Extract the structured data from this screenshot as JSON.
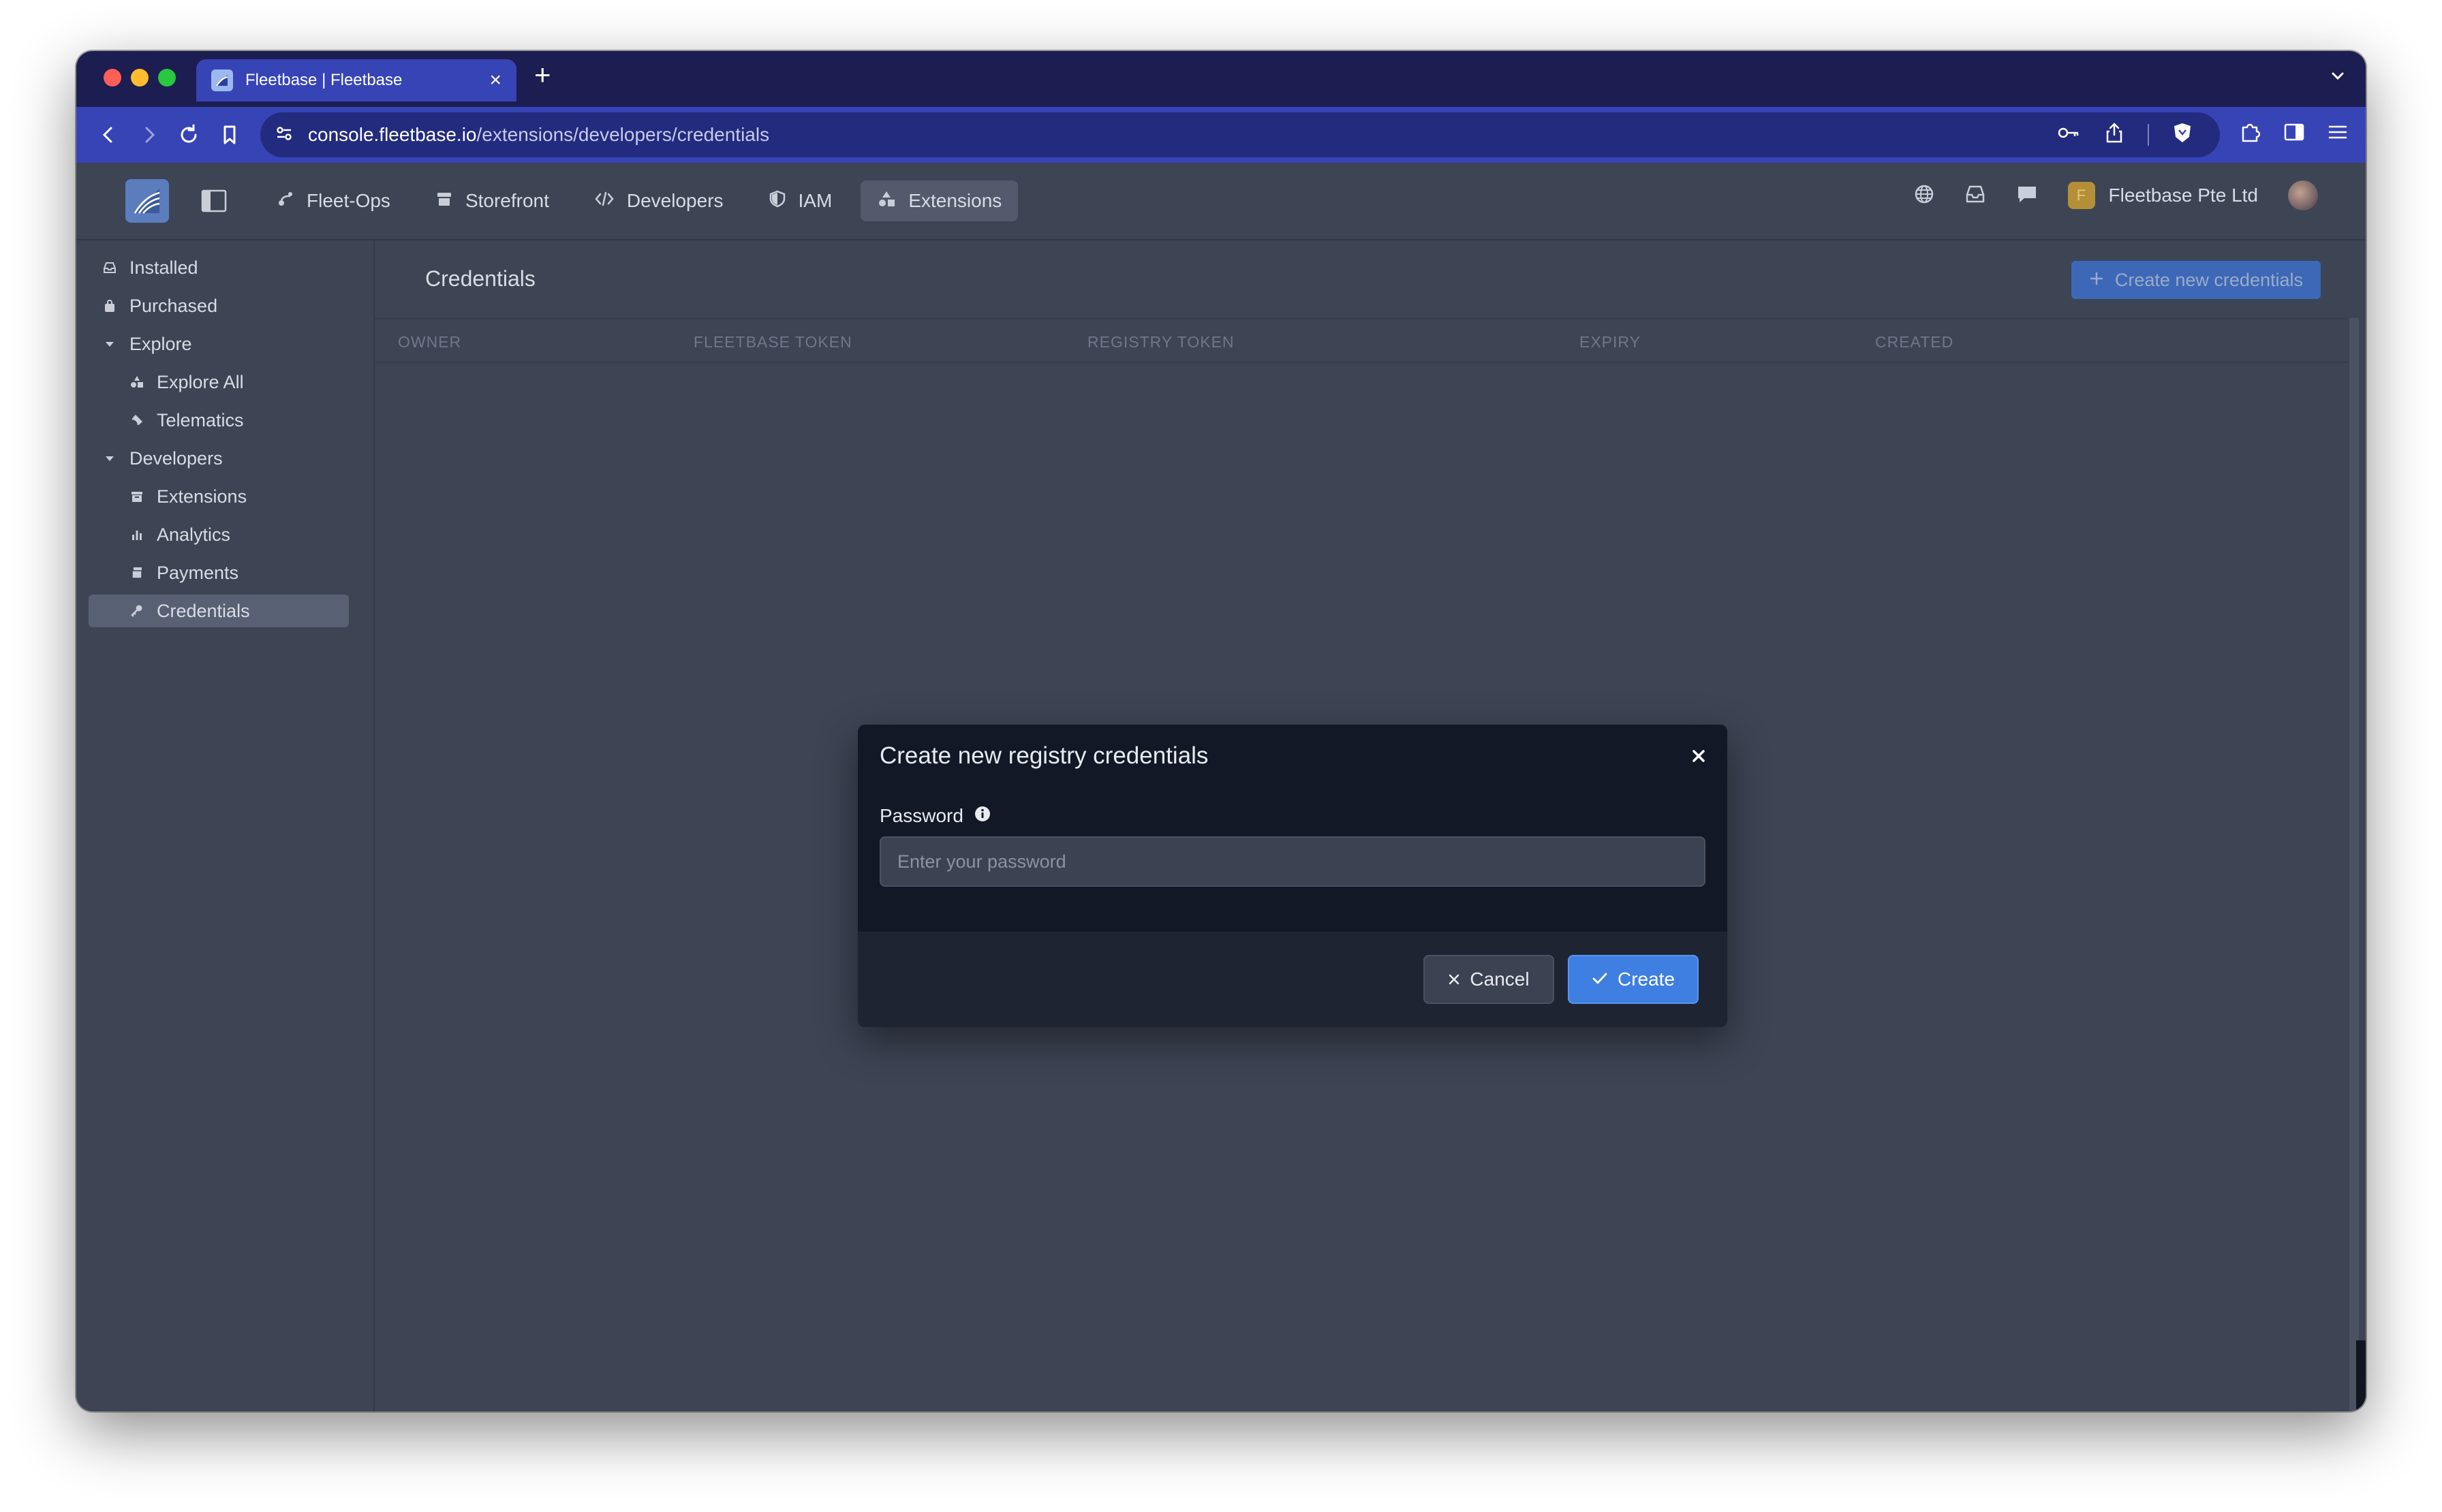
{
  "browser": {
    "tab_title": "Fleetbase | Fleetbase",
    "new_tab_symbol": "+",
    "close_symbol": "×",
    "url_domain": "console.fleetbase.io",
    "url_path": "/extensions/developers/credentials"
  },
  "header": {
    "nav": [
      {
        "label": "Fleet-Ops",
        "icon": "route-icon"
      },
      {
        "label": "Storefront",
        "icon": "store-icon"
      },
      {
        "label": "Developers",
        "icon": "code-icon"
      },
      {
        "label": "IAM",
        "icon": "shield-icon"
      },
      {
        "label": "Extensions",
        "icon": "shapes-icon",
        "active": true
      }
    ],
    "org_initial": "F",
    "org_name": "Fleetbase Pte Ltd"
  },
  "sidebar": {
    "items": [
      {
        "label": "Installed",
        "icon": "inbox-icon"
      },
      {
        "label": "Purchased",
        "icon": "bag-icon"
      },
      {
        "label": "Explore",
        "icon": "caret-down-icon"
      },
      {
        "label": "Explore All",
        "icon": "shapes-icon"
      },
      {
        "label": "Telematics",
        "icon": "satellite-icon"
      },
      {
        "label": "Developers",
        "icon": "caret-down-icon"
      },
      {
        "label": "Extensions",
        "icon": "archive-icon"
      },
      {
        "label": "Analytics",
        "icon": "chart-icon"
      },
      {
        "label": "Payments",
        "icon": "cash-icon"
      },
      {
        "label": "Credentials",
        "icon": "key-icon",
        "active": true
      }
    ]
  },
  "main": {
    "title": "Credentials",
    "create_button": "Create new credentials",
    "columns": [
      "OWNER",
      "FLEETBASE TOKEN",
      "REGISTRY TOKEN",
      "EXPIRY",
      "CREATED"
    ]
  },
  "modal": {
    "title": "Create new registry credentials",
    "password_label": "Password",
    "password_placeholder": "Enter your password",
    "password_value": "",
    "cancel_label": "Cancel",
    "create_label": "Create"
  },
  "colors": {
    "tabbar": "#1c1d50",
    "addressbar": "#3744b6",
    "app_bg": "#3d4454",
    "modal_bg": "#121826",
    "primary_button": "#3e7fe1"
  }
}
